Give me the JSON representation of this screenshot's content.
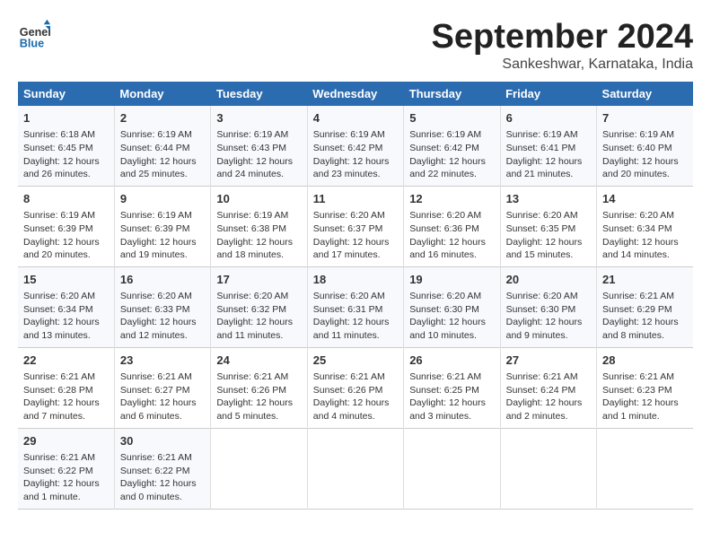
{
  "header": {
    "logo_line1": "General",
    "logo_line2": "Blue",
    "month": "September 2024",
    "location": "Sankeshwar, Karnataka, India"
  },
  "weekdays": [
    "Sunday",
    "Monday",
    "Tuesday",
    "Wednesday",
    "Thursday",
    "Friday",
    "Saturday"
  ],
  "weeks": [
    [
      {
        "day": "1",
        "info": "Sunrise: 6:18 AM\nSunset: 6:45 PM\nDaylight: 12 hours\nand 26 minutes."
      },
      {
        "day": "2",
        "info": "Sunrise: 6:19 AM\nSunset: 6:44 PM\nDaylight: 12 hours\nand 25 minutes."
      },
      {
        "day": "3",
        "info": "Sunrise: 6:19 AM\nSunset: 6:43 PM\nDaylight: 12 hours\nand 24 minutes."
      },
      {
        "day": "4",
        "info": "Sunrise: 6:19 AM\nSunset: 6:42 PM\nDaylight: 12 hours\nand 23 minutes."
      },
      {
        "day": "5",
        "info": "Sunrise: 6:19 AM\nSunset: 6:42 PM\nDaylight: 12 hours\nand 22 minutes."
      },
      {
        "day": "6",
        "info": "Sunrise: 6:19 AM\nSunset: 6:41 PM\nDaylight: 12 hours\nand 21 minutes."
      },
      {
        "day": "7",
        "info": "Sunrise: 6:19 AM\nSunset: 6:40 PM\nDaylight: 12 hours\nand 20 minutes."
      }
    ],
    [
      {
        "day": "8",
        "info": "Sunrise: 6:19 AM\nSunset: 6:39 PM\nDaylight: 12 hours\nand 20 minutes."
      },
      {
        "day": "9",
        "info": "Sunrise: 6:19 AM\nSunset: 6:39 PM\nDaylight: 12 hours\nand 19 minutes."
      },
      {
        "day": "10",
        "info": "Sunrise: 6:19 AM\nSunset: 6:38 PM\nDaylight: 12 hours\nand 18 minutes."
      },
      {
        "day": "11",
        "info": "Sunrise: 6:20 AM\nSunset: 6:37 PM\nDaylight: 12 hours\nand 17 minutes."
      },
      {
        "day": "12",
        "info": "Sunrise: 6:20 AM\nSunset: 6:36 PM\nDaylight: 12 hours\nand 16 minutes."
      },
      {
        "day": "13",
        "info": "Sunrise: 6:20 AM\nSunset: 6:35 PM\nDaylight: 12 hours\nand 15 minutes."
      },
      {
        "day": "14",
        "info": "Sunrise: 6:20 AM\nSunset: 6:34 PM\nDaylight: 12 hours\nand 14 minutes."
      }
    ],
    [
      {
        "day": "15",
        "info": "Sunrise: 6:20 AM\nSunset: 6:34 PM\nDaylight: 12 hours\nand 13 minutes."
      },
      {
        "day": "16",
        "info": "Sunrise: 6:20 AM\nSunset: 6:33 PM\nDaylight: 12 hours\nand 12 minutes."
      },
      {
        "day": "17",
        "info": "Sunrise: 6:20 AM\nSunset: 6:32 PM\nDaylight: 12 hours\nand 11 minutes."
      },
      {
        "day": "18",
        "info": "Sunrise: 6:20 AM\nSunset: 6:31 PM\nDaylight: 12 hours\nand 11 minutes."
      },
      {
        "day": "19",
        "info": "Sunrise: 6:20 AM\nSunset: 6:30 PM\nDaylight: 12 hours\nand 10 minutes."
      },
      {
        "day": "20",
        "info": "Sunrise: 6:20 AM\nSunset: 6:30 PM\nDaylight: 12 hours\nand 9 minutes."
      },
      {
        "day": "21",
        "info": "Sunrise: 6:21 AM\nSunset: 6:29 PM\nDaylight: 12 hours\nand 8 minutes."
      }
    ],
    [
      {
        "day": "22",
        "info": "Sunrise: 6:21 AM\nSunset: 6:28 PM\nDaylight: 12 hours\nand 7 minutes."
      },
      {
        "day": "23",
        "info": "Sunrise: 6:21 AM\nSunset: 6:27 PM\nDaylight: 12 hours\nand 6 minutes."
      },
      {
        "day": "24",
        "info": "Sunrise: 6:21 AM\nSunset: 6:26 PM\nDaylight: 12 hours\nand 5 minutes."
      },
      {
        "day": "25",
        "info": "Sunrise: 6:21 AM\nSunset: 6:26 PM\nDaylight: 12 hours\nand 4 minutes."
      },
      {
        "day": "26",
        "info": "Sunrise: 6:21 AM\nSunset: 6:25 PM\nDaylight: 12 hours\nand 3 minutes."
      },
      {
        "day": "27",
        "info": "Sunrise: 6:21 AM\nSunset: 6:24 PM\nDaylight: 12 hours\nand 2 minutes."
      },
      {
        "day": "28",
        "info": "Sunrise: 6:21 AM\nSunset: 6:23 PM\nDaylight: 12 hours\nand 1 minute."
      }
    ],
    [
      {
        "day": "29",
        "info": "Sunrise: 6:21 AM\nSunset: 6:22 PM\nDaylight: 12 hours\nand 1 minute."
      },
      {
        "day": "30",
        "info": "Sunrise: 6:21 AM\nSunset: 6:22 PM\nDaylight: 12 hours\nand 0 minutes."
      },
      null,
      null,
      null,
      null,
      null
    ]
  ]
}
